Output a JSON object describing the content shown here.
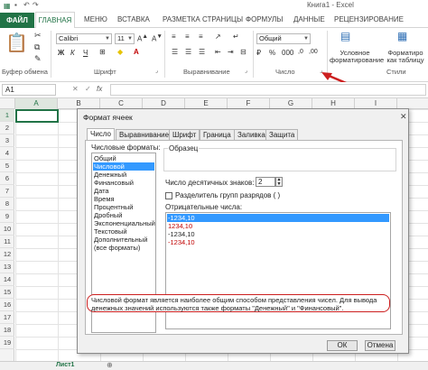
{
  "window": {
    "title": "Книга1 - Excel"
  },
  "ribbon_tabs": [
    "ФАЙЛ",
    "ГЛАВНАЯ",
    "МЕНЮ",
    "ВСТАВКА",
    "РАЗМЕТКА СТРАНИЦЫ",
    "ФОРМУЛЫ",
    "ДАННЫЕ",
    "РЕЦЕНЗИРОВАНИЕ"
  ],
  "ribbon": {
    "font_name": "Calibri",
    "font_size": "11",
    "number_format": "Общий",
    "groups": [
      "Буфер обмена",
      "Шрифт",
      "Выравнивание",
      "Число",
      "Стили"
    ],
    "conditional_formatting": [
      "Условное",
      "форматирование"
    ],
    "format_as_table": [
      "Форматиро",
      "как таблицу"
    ]
  },
  "name_box": "A1",
  "columns": [
    "A",
    "B",
    "C",
    "D",
    "E",
    "F",
    "G",
    "H",
    "I"
  ],
  "rows": [
    "1",
    "2",
    "3",
    "4",
    "5",
    "6",
    "7",
    "8",
    "9",
    "10",
    "11",
    "12",
    "13",
    "14",
    "15",
    "16",
    "17",
    "18",
    "19"
  ],
  "sheet_tab": "Лист1",
  "dialog": {
    "title": "Формат ячеек",
    "tabs": [
      "Число",
      "Выравнивание",
      "Шрифт",
      "Граница",
      "Заливка",
      "Защита"
    ],
    "formats_label": "Числовые форматы:",
    "formats": [
      "Общий",
      "Числовой",
      "Денежный",
      "Финансовый",
      "Дата",
      "Время",
      "Процентный",
      "Дробный",
      "Экспоненциальный",
      "Текстовый",
      "Дополнительный",
      "(все форматы)"
    ],
    "selected_format": "Числовой",
    "sample_label": "Образец",
    "decimals_label": "Число десятичных знаков:",
    "decimals_value": "2",
    "separator_label": "Разделитель групп разрядов ( )",
    "negative_label": "Отрицательные числа:",
    "negative_options": [
      "-1234,10",
      "1234,10",
      "-1234,10",
      "-1234,10"
    ],
    "description": "Числовой формат является наиболее общим способом представления чисел. Для вывода денежных значений используются также форматы \"Денежный\" и \"Финансовый\".",
    "ok_label": "ОК",
    "cancel_label": "Отмена"
  },
  "colors": {
    "excel_green": "#217346",
    "selection_blue": "#3399ff",
    "annotation_red": "#cc1f1f",
    "negative_red": "#c00000"
  }
}
